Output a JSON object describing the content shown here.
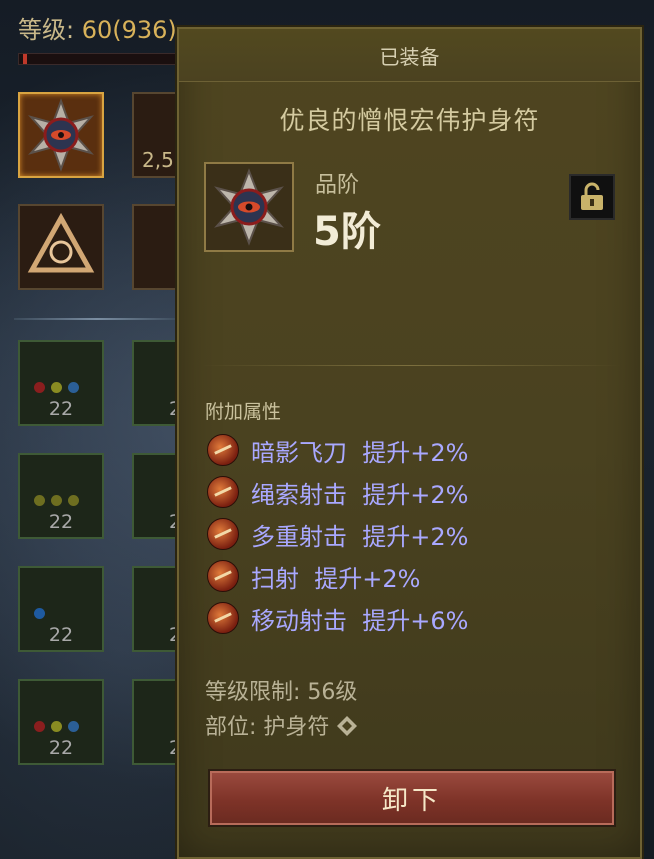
{
  "background": {
    "level_label": "等级: ",
    "level_value": "60(936)",
    "slot_badge": "2,5",
    "gem_counts": [
      "22",
      "22",
      "22",
      "22"
    ],
    "gem_counts_col2": [
      "2",
      "2",
      "2",
      "2"
    ]
  },
  "tooltip": {
    "header": "已装备",
    "item_name": "优良的憎恨宏伟护身符",
    "rank_label": "品阶",
    "rank_value": "5阶",
    "attributes_title": "附加属性",
    "attributes": [
      {
        "text": "暗影飞刀  提升+2%",
        "icon": "skill-shadow-knife-icon"
      },
      {
        "text": "绳索射击  提升+2%",
        "icon": "skill-rope-shot-icon"
      },
      {
        "text": "多重射击  提升+2%",
        "icon": "skill-multishot-icon"
      },
      {
        "text": "扫射  提升+2%",
        "icon": "skill-strafe-icon"
      },
      {
        "text": "移动射击  提升+6%",
        "icon": "skill-moving-shot-icon"
      }
    ],
    "level_requirement": "等级限制: 56级",
    "slot_label": "部位: 护身符",
    "unequip_label": "卸下"
  },
  "colors": {
    "panel_bg": "#4a4220",
    "attribute_text": "#a9a8ff",
    "button_bg": "#7e3328"
  }
}
